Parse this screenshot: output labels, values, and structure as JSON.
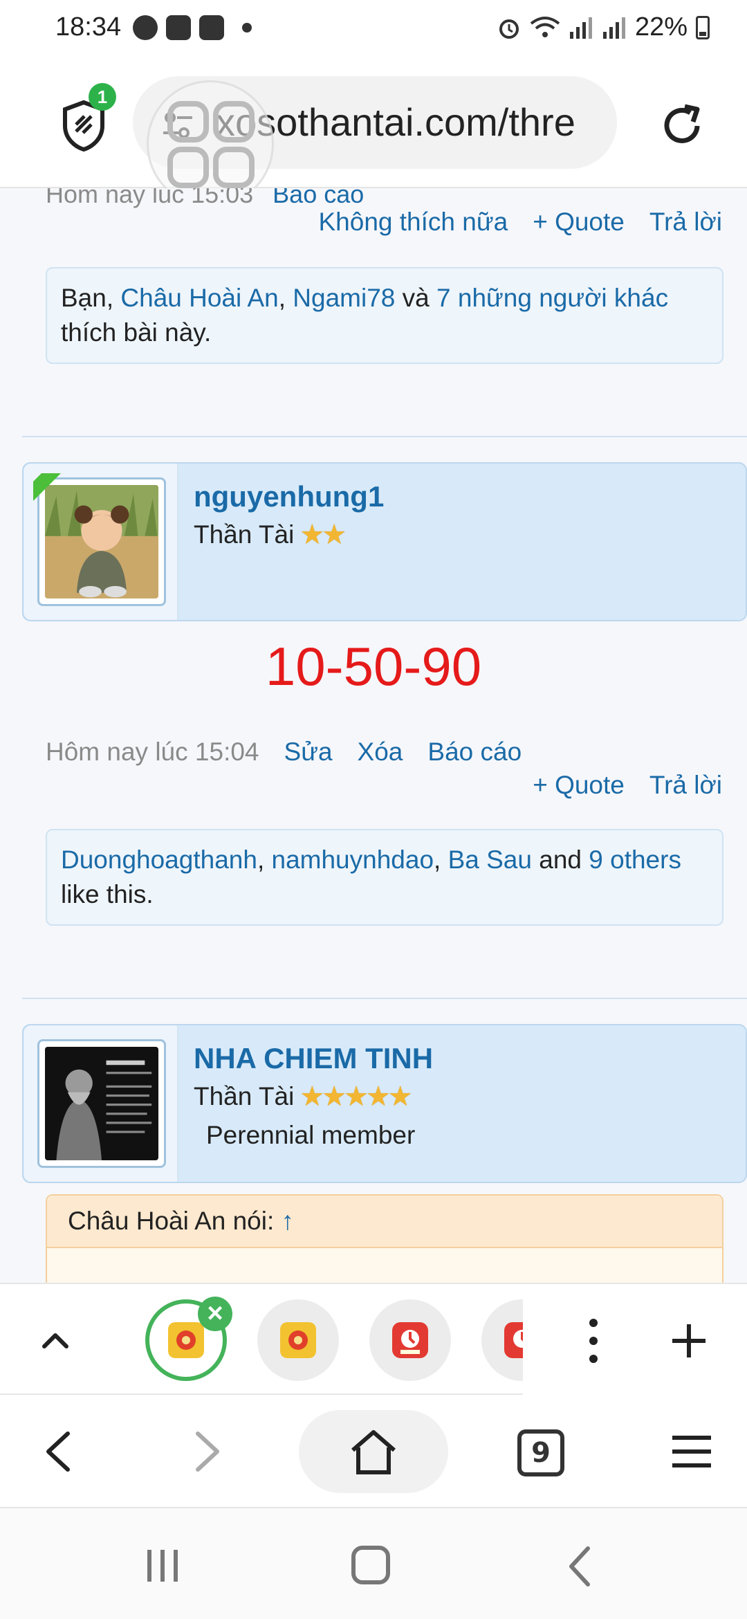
{
  "status_bar": {
    "time": "18:34",
    "battery": "22%"
  },
  "browser": {
    "url": "xosothantai.com/thre",
    "shield_badge": "1",
    "tab_count": "9"
  },
  "previous_post": {
    "clipped_text": "Hôm nay lúc 15:03",
    "clipped_link": "Báo cáo",
    "actions": [
      "Không thích nữa",
      "+ Quote",
      "Trả lời"
    ],
    "likes": {
      "prefix": "Bạn, ",
      "user1": "Châu Hoài An",
      "sep": ", ",
      "user2": "Ngami78",
      "and": " và ",
      "others": "7 những người khác",
      "suffix": "thích bài này."
    }
  },
  "post": {
    "username": "nguyenhung1",
    "rank": "Thần Tài",
    "stars": "★★",
    "content": "10-50-90",
    "time": "Hôm nay lúc 15:04",
    "meta_links": [
      "Sửa",
      "Xóa",
      "Báo cáo"
    ],
    "actions": [
      "+ Quote",
      "Trả lời"
    ],
    "likes": {
      "user1": "Duonghoagthanh",
      "sep1": ", ",
      "user2": "namhuynhdao",
      "sep2": ", ",
      "user3": "Ba Sau",
      "and": " and ",
      "others": "9 others",
      "suffix": "like this."
    }
  },
  "next_post": {
    "username": "NHA CHIEM TINH",
    "rank": "Thần Tài",
    "stars": "★★★★★",
    "title": "Perennial member",
    "quote_author": "Châu Hoài An nói: ",
    "quote_arrow": "↑"
  },
  "colors": {
    "link": "#1a6aa7",
    "post_number": "#e51a1a",
    "tab_active": "#44b35a"
  }
}
